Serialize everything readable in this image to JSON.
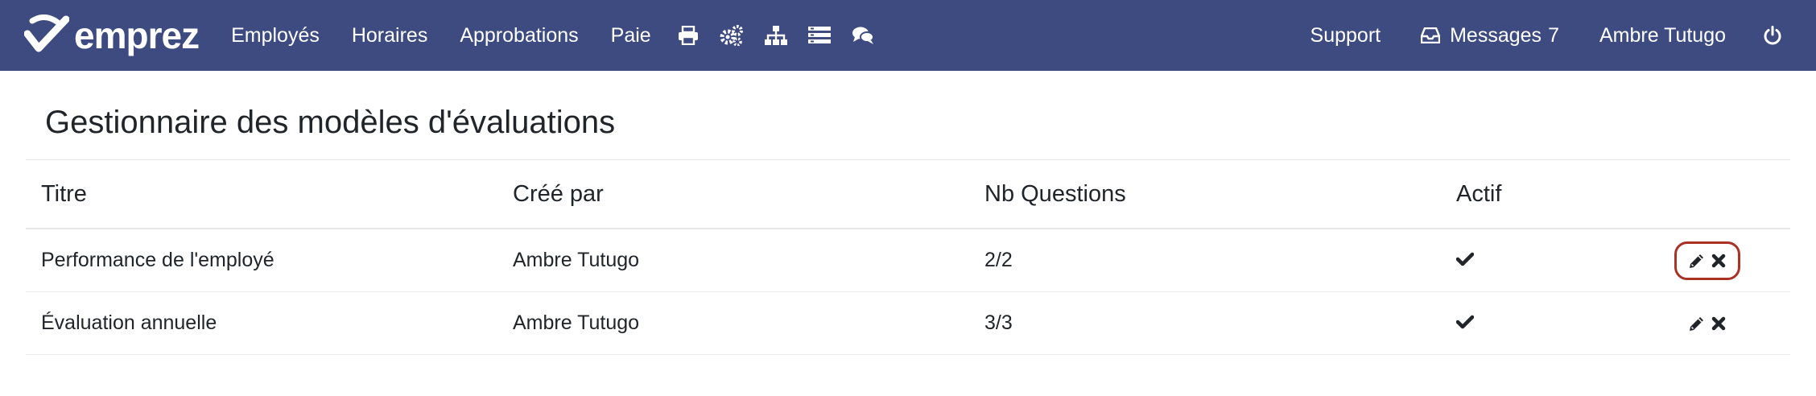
{
  "header": {
    "brand": "emprez",
    "nav": [
      {
        "label": "Employés"
      },
      {
        "label": "Horaires"
      },
      {
        "label": "Approbations"
      },
      {
        "label": "Paie"
      }
    ],
    "icons": [
      "print-icon",
      "gears-icon",
      "org-chart-icon",
      "list-icon",
      "chat-icon"
    ],
    "right": {
      "support": "Support",
      "messages_label": "Messages",
      "messages_count": "7",
      "user": "Ambre Tutugo"
    }
  },
  "page": {
    "title": "Gestionnaire des modèles d'évaluations"
  },
  "table": {
    "headers": {
      "title": "Titre",
      "author": "Créé par",
      "count": "Nb Questions",
      "active": "Actif"
    },
    "rows": [
      {
        "title": "Performance de l'employé",
        "author": "Ambre Tutugo",
        "count": "2/2",
        "active": true,
        "highlighted": true
      },
      {
        "title": "Évaluation annuelle",
        "author": "Ambre Tutugo",
        "count": "3/3",
        "active": true,
        "highlighted": false
      }
    ]
  },
  "colors": {
    "navbar": "#3d4b80",
    "highlight": "#a93226",
    "text": "#212529"
  }
}
